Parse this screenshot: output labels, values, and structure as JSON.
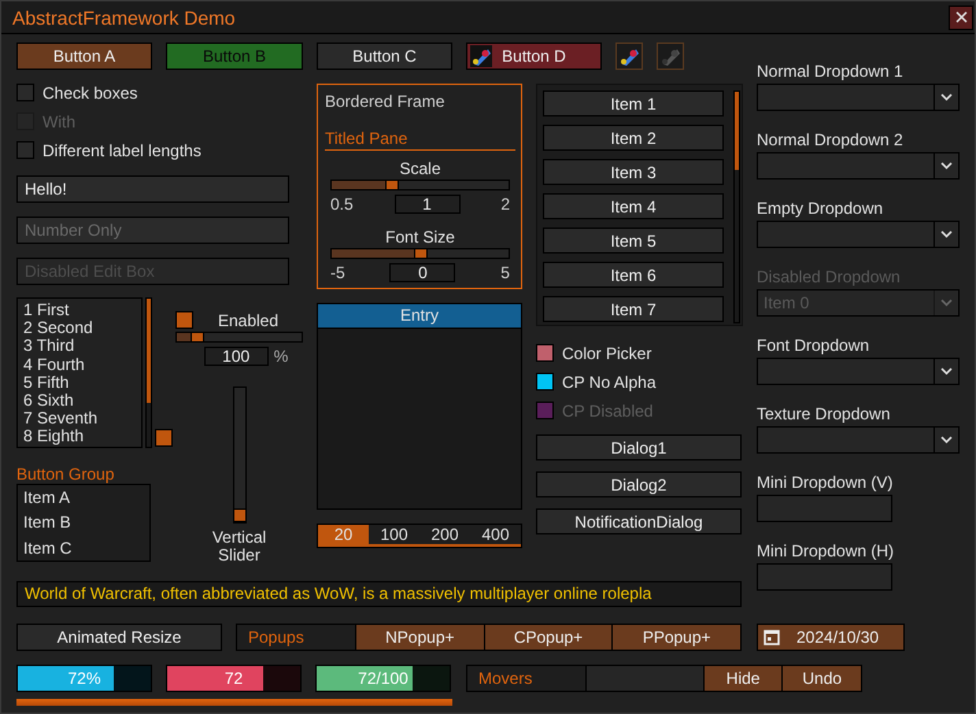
{
  "window": {
    "title": "AbstractFramework Demo"
  },
  "buttons": [
    {
      "label": "Button A",
      "color": "#6b3b1e",
      "disabled": false,
      "icon": false
    },
    {
      "label": "Button B",
      "color": "#226b22",
      "disabled": true,
      "icon": false
    },
    {
      "label": "Button C",
      "color": "#2a2a2a",
      "disabled": false,
      "icon": false
    },
    {
      "label": "Button D",
      "color": "#6b1f24",
      "disabled": false,
      "icon": true
    }
  ],
  "icon_buttons": [
    {
      "disabled": false
    },
    {
      "disabled": true
    }
  ],
  "checkboxes": [
    {
      "label": "Check boxes",
      "checked": false,
      "disabled": false
    },
    {
      "label": "With",
      "checked": false,
      "disabled": true
    },
    {
      "label": "Different label lengths",
      "checked": false,
      "disabled": false
    }
  ],
  "edit_boxes": [
    {
      "value": "Hello!",
      "disabled": false
    },
    {
      "placeholder": "Number Only",
      "disabled": false
    },
    {
      "placeholder": "Disabled Edit Box",
      "disabled": true
    }
  ],
  "list_box": {
    "items": [
      "1 First",
      "2 Second",
      "3 Third",
      "4 Fourth",
      "5 Fifth",
      "6 Sixth",
      "7 Seventh",
      "8 Eighth"
    ]
  },
  "enabled_slider": {
    "label": "Enabled",
    "checked": true,
    "level": 0.12,
    "value": "100",
    "unit": "%"
  },
  "vertical_slider": {
    "label": "Vertical Slider",
    "level": 0
  },
  "button_group": {
    "title": "Button Group",
    "items": [
      {
        "label": "Item A",
        "selected": false
      },
      {
        "label": "Item B",
        "selected": false
      },
      {
        "label": "Item C",
        "selected": false
      }
    ]
  },
  "bordered_frame": {
    "title": "Bordered Frame",
    "pane_title": "Titled Pane",
    "sliders": [
      {
        "label": "Scale",
        "min": "0.5",
        "max": "2",
        "value": "1",
        "level": 0.33
      },
      {
        "label": "Font Size",
        "min": "-5",
        "max": "5",
        "value": "0",
        "level": 0.5
      }
    ]
  },
  "entry_table": {
    "header": "Entry"
  },
  "page_sizes": [
    {
      "label": "20",
      "selected": true
    },
    {
      "label": "100",
      "selected": false
    },
    {
      "label": "200",
      "selected": false
    },
    {
      "label": "400",
      "selected": false
    }
  ],
  "item_list": {
    "items": [
      "Item 1",
      "Item 2",
      "Item 3",
      "Item 4",
      "Item 5",
      "Item 6",
      "Item 7"
    ]
  },
  "color_pickers": [
    {
      "label": "Color Picker",
      "color": "#c0606c",
      "disabled": false
    },
    {
      "label": "CP No Alpha",
      "color": "#00c4f4",
      "disabled": false
    },
    {
      "label": "CP Disabled",
      "color": "#5a1e5a",
      "disabled": true
    }
  ],
  "dialog_buttons": [
    "Dialog1",
    "Dialog2",
    "NotificationDialog"
  ],
  "dropdowns": [
    {
      "label": "Normal Dropdown 1",
      "kind": "full",
      "disabled": false
    },
    {
      "label": "Normal Dropdown 2",
      "kind": "full",
      "disabled": false
    },
    {
      "label": "Empty Dropdown",
      "kind": "full",
      "disabled": false
    },
    {
      "label": "Disabled Dropdown",
      "kind": "full",
      "disabled": true,
      "value": "Item 0"
    },
    {
      "label": "Font Dropdown",
      "kind": "full",
      "disabled": false
    },
    {
      "label": "Texture Dropdown",
      "kind": "full",
      "disabled": false
    },
    {
      "label": "Mini Dropdown (V)",
      "kind": "mini",
      "disabled": false
    },
    {
      "label": "Mini Dropdown (H)",
      "kind": "mini",
      "disabled": false
    }
  ],
  "scrolling_text": "World of Warcraft, often abbreviated as WoW, is a massively multiplayer online rolepla",
  "animated_resize_button": "Animated Resize",
  "popups": {
    "title": "Popups",
    "buttons": [
      "NPopup+",
      "CPopup+",
      "PPopup+"
    ]
  },
  "date_picker": {
    "value": "2024/10/30"
  },
  "progress_bars": [
    {
      "label": "72%",
      "level": 0.72,
      "color": "#18b2e0"
    },
    {
      "label": "72",
      "level": 0.72,
      "color": "#e0445f"
    },
    {
      "label": "72/100",
      "level": 0.72,
      "color": "#5cba7c"
    }
  ],
  "long_progress": {
    "level": 1
  },
  "movers": {
    "title": "Movers",
    "buttons": [
      "Hide",
      "Undo"
    ]
  }
}
